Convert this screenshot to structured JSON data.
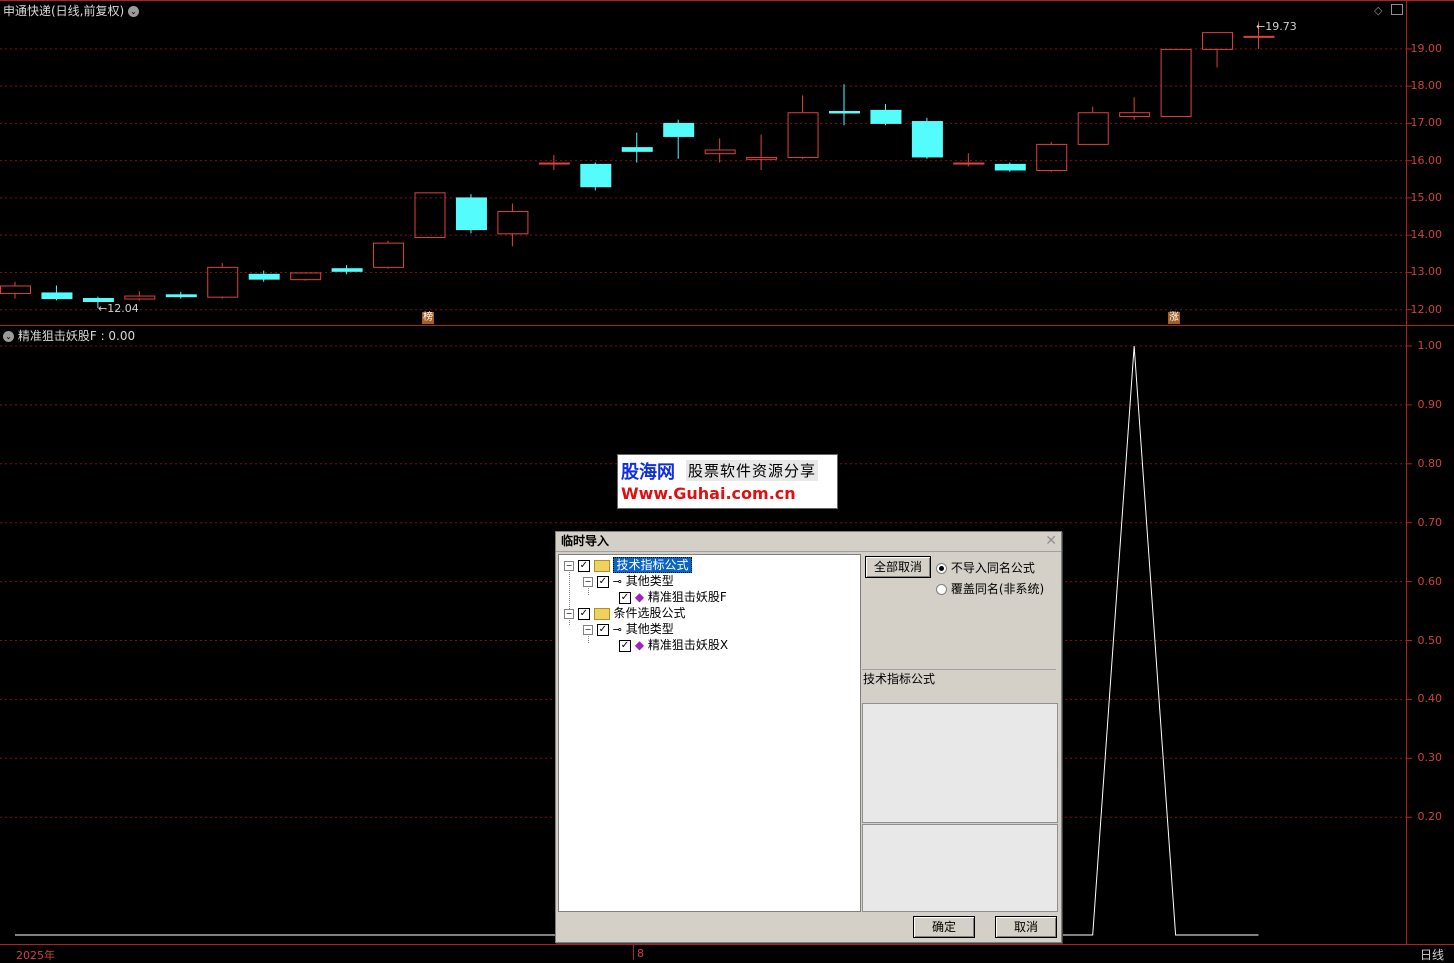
{
  "top_header": {
    "title": "申通快递(日线,前复权)"
  },
  "bottom_header": {
    "title": "精准狙击妖股F",
    "value": ": 0.00"
  },
  "price_axis_ticks": [
    "19.00",
    "18.00",
    "17.00",
    "16.00",
    "15.00",
    "14.00",
    "13.00",
    "12.00"
  ],
  "indicator_axis_ticks": [
    "1.00",
    "0.90",
    "0.80",
    "0.70",
    "0.60",
    "0.50",
    "0.40",
    "0.30",
    "0.20"
  ],
  "annotations": {
    "low": "12.04",
    "high": "19.73"
  },
  "markers": [
    "榜",
    "涨"
  ],
  "time_axis": {
    "year": "2025年",
    "month": "8",
    "period": "日线"
  },
  "colors": {
    "up": "#e04040",
    "down": "#54fcfc",
    "grid": "#801010",
    "background": "#000000"
  },
  "watermark": {
    "line1": "股海网",
    "line2": "股票软件资源分享",
    "line3": "Www.Guhai.com.cn"
  },
  "dialog": {
    "title": "临时导入",
    "tree": [
      {
        "label": "技术指标公式",
        "level": 0,
        "icon": "folder-icon",
        "selected": true
      },
      {
        "label": "其他类型",
        "level": 1,
        "icon": "key-icon"
      },
      {
        "label": "精准狙击妖股F",
        "level": 2,
        "icon": "diamond-icon"
      },
      {
        "label": "条件选股公式",
        "level": 0,
        "icon": "folder-icon"
      },
      {
        "label": "其他类型",
        "level": 1,
        "icon": "key-icon"
      },
      {
        "label": "精准狙击妖股X",
        "level": 2,
        "icon": "diamond-icon"
      }
    ],
    "cancel_all_label": "全部取消",
    "radio_options": [
      "不导入同名公式",
      "覆盖同名(非系统)"
    ],
    "category_label": "技术指标公式",
    "ok_label": "确定",
    "cancel_label": "取消"
  },
  "chart_data": {
    "type": "candlestick",
    "candles": [
      {
        "o": 12.45,
        "h": 12.75,
        "l": 12.3,
        "c": 12.65
      },
      {
        "o": 12.45,
        "h": 12.65,
        "l": 12.25,
        "c": 12.3
      },
      {
        "o": 12.3,
        "h": 12.35,
        "l": 12.04,
        "c": 12.22
      },
      {
        "o": 12.3,
        "h": 12.5,
        "l": 12.25,
        "c": 12.38
      },
      {
        "o": 12.4,
        "h": 12.48,
        "l": 12.3,
        "c": 12.35
      },
      {
        "o": 12.35,
        "h": 13.25,
        "l": 12.3,
        "c": 13.15
      },
      {
        "o": 12.95,
        "h": 13.05,
        "l": 12.75,
        "c": 12.82
      },
      {
        "o": 12.82,
        "h": 13.0,
        "l": 12.78,
        "c": 13.0
      },
      {
        "o": 13.1,
        "h": 13.2,
        "l": 12.95,
        "c": 13.03
      },
      {
        "o": 13.15,
        "h": 13.85,
        "l": 13.1,
        "c": 13.8
      },
      {
        "o": 13.95,
        "h": 15.15,
        "l": 13.95,
        "c": 15.15
      },
      {
        "o": 15.0,
        "h": 15.1,
        "l": 14.05,
        "c": 14.15
      },
      {
        "o": 14.05,
        "h": 14.85,
        "l": 13.7,
        "c": 14.65
      },
      {
        "o": 15.95,
        "h": 16.15,
        "l": 15.75,
        "c": 15.95
      },
      {
        "o": 15.9,
        "h": 15.95,
        "l": 15.2,
        "c": 15.3
      },
      {
        "o": 16.35,
        "h": 16.75,
        "l": 15.95,
        "c": 16.25
      },
      {
        "o": 17.0,
        "h": 17.1,
        "l": 16.05,
        "c": 16.65
      },
      {
        "o": 16.2,
        "h": 16.6,
        "l": 15.95,
        "c": 16.3
      },
      {
        "o": 16.05,
        "h": 16.7,
        "l": 15.75,
        "c": 16.1
      },
      {
        "o": 16.1,
        "h": 17.75,
        "l": 16.05,
        "c": 17.3
      },
      {
        "o": 17.32,
        "h": 18.05,
        "l": 16.95,
        "c": 17.28
      },
      {
        "o": 17.35,
        "h": 17.52,
        "l": 16.95,
        "c": 17.0
      },
      {
        "o": 17.05,
        "h": 17.15,
        "l": 16.05,
        "c": 16.1
      },
      {
        "o": 15.95,
        "h": 16.2,
        "l": 15.85,
        "c": 15.95
      },
      {
        "o": 15.9,
        "h": 15.95,
        "l": 15.7,
        "c": 15.75
      },
      {
        "o": 15.75,
        "h": 16.5,
        "l": 15.7,
        "c": 16.45
      },
      {
        "o": 16.45,
        "h": 17.45,
        "l": 16.45,
        "c": 17.3
      },
      {
        "o": 17.2,
        "h": 17.7,
        "l": 17.1,
        "c": 17.3
      },
      {
        "o": 17.2,
        "h": 19.0,
        "l": 17.2,
        "c": 19.0
      },
      {
        "o": 19.0,
        "h": 19.45,
        "l": 18.5,
        "c": 19.45
      },
      {
        "o": 19.35,
        "h": 19.73,
        "l": 19.0,
        "c": 19.35
      }
    ],
    "price_range": [
      11.67,
      19.99
    ],
    "indicator": {
      "name": "精准狙击妖股F",
      "values": [
        0,
        0,
        0,
        0,
        0,
        0,
        0,
        0,
        0,
        0,
        0,
        0,
        0,
        0,
        0,
        0,
        0,
        0,
        0,
        0,
        0,
        0,
        0,
        0,
        0,
        0,
        0,
        1,
        0,
        0,
        0
      ],
      "range": [
        0,
        1
      ]
    }
  }
}
